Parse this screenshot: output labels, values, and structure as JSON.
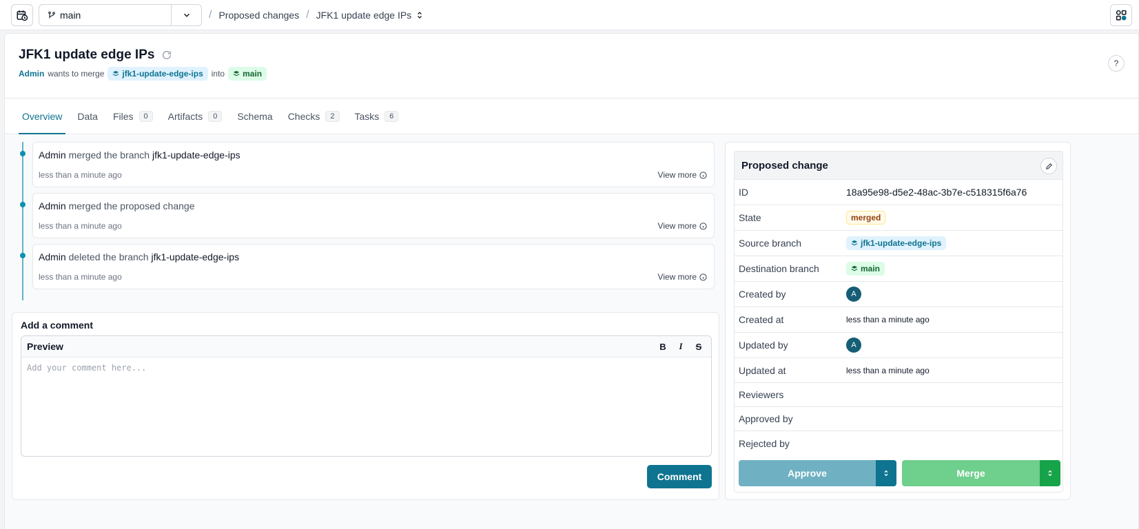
{
  "topbar": {
    "branch": "main",
    "breadcrumbs": [
      "Proposed changes",
      "JFK1 update edge IPs"
    ],
    "sep": "/"
  },
  "header": {
    "title": "JFK1 update edge IPs",
    "author": "Admin",
    "wants_text": "wants to merge",
    "source_branch": "jfk1-update-edge-ips",
    "into_text": "into",
    "dest_branch": "main",
    "help": "?"
  },
  "tabs": [
    {
      "label": "Overview"
    },
    {
      "label": "Data"
    },
    {
      "label": "Files",
      "count": "0"
    },
    {
      "label": "Artifacts",
      "count": "0"
    },
    {
      "label": "Schema"
    },
    {
      "label": "Checks",
      "count": "2"
    },
    {
      "label": "Tasks",
      "count": "6"
    }
  ],
  "events": [
    {
      "actor": "Admin",
      "action": "merged the branch",
      "target": "jfk1-update-edge-ips",
      "time": "less than a minute ago",
      "view_more": "View more"
    },
    {
      "actor": "Admin",
      "action": "merged the proposed change",
      "target": "",
      "time": "less than a minute ago",
      "view_more": "View more"
    },
    {
      "actor": "Admin",
      "action": "deleted the branch",
      "target": "jfk1-update-edge-ips",
      "time": "less than a minute ago",
      "view_more": "View more"
    }
  ],
  "comment": {
    "title": "Add a comment",
    "preview_label": "Preview",
    "bold": "B",
    "italic": "I",
    "strike": "S",
    "placeholder": "Add your comment here...",
    "submit": "Comment"
  },
  "side": {
    "title": "Proposed change",
    "id_label": "ID",
    "id_value": "18a95e98-d5e2-48ac-3b7e-c518315f6a76",
    "state_label": "State",
    "state_value": "merged",
    "source_label": "Source branch",
    "source_value": "jfk1-update-edge-ips",
    "dest_label": "Destination branch",
    "dest_value": "main",
    "created_by_label": "Created by",
    "created_by_avatar": "A",
    "created_at_label": "Created at",
    "created_at_value": "less than a minute ago",
    "updated_by_label": "Updated by",
    "updated_by_avatar": "A",
    "updated_at_label": "Updated at",
    "updated_at_value": "less than a minute ago",
    "reviewers_label": "Reviewers",
    "approved_by_label": "Approved by",
    "rejected_by_label": "Rejected by",
    "approve": "Approve",
    "merge": "Merge"
  },
  "colors": {
    "accent": "#0e7490",
    "merge_green": "#16a34a"
  }
}
